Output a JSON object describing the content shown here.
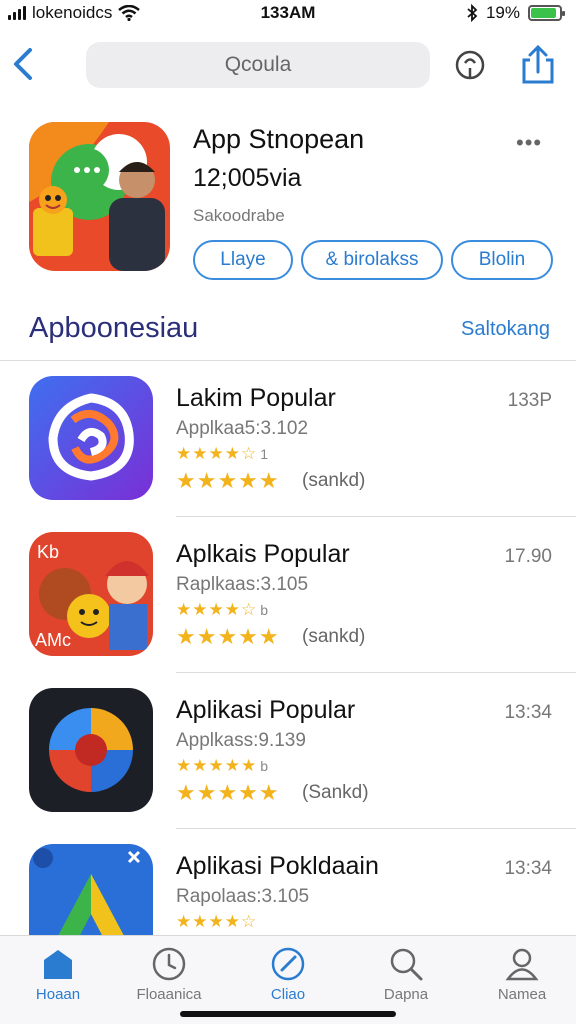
{
  "status_bar": {
    "carrier": "lokenoidcs",
    "time": "133AM",
    "battery_text": "19%",
    "battery_level": 0.9
  },
  "nav": {
    "search_placeholder": "Qcoula"
  },
  "featured": {
    "title": "App Stnopean",
    "subtitle": "12;005via",
    "developer": "Sakoodrabe",
    "more_label": "•••",
    "buttons": [
      "Llaye",
      "& birolakss",
      "Blolin"
    ]
  },
  "section": {
    "title": "Apboonesiau",
    "see_all": "Saltokang"
  },
  "apps": [
    {
      "name": "Lakim Popular",
      "subtitle": "Applkaa5:3.102",
      "size": "133P",
      "stars_small": "★★★★☆",
      "small_extra": "1",
      "stars_big": "★★★★★",
      "reviews": "(sankd)",
      "icon": "swirl-app-icon"
    },
    {
      "name": "Aplkais Popular",
      "subtitle": "Raplkaas:3.105",
      "size": "17.90",
      "stars_small": "★★★★☆",
      "small_extra": "b",
      "stars_big": "★★★★★",
      "reviews": "(sankd)",
      "icon": "cartoon-app-icon"
    },
    {
      "name": "Aplikasi Popular",
      "subtitle": "Applkass:9.139",
      "size": "13:34",
      "stars_small": "★★★★★",
      "small_extra": "b",
      "stars_big": "★★★★★",
      "reviews": "(Sankd)",
      "icon": "circle-app-icon"
    },
    {
      "name": "Aplikasi Pokldaain",
      "subtitle": "Rapolaas:3.105",
      "size": "13:34",
      "stars_small": "★★★★☆",
      "small_extra": "",
      "stars_big": "",
      "reviews": "",
      "icon": "arrow-app-icon"
    }
  ],
  "tabs": [
    {
      "label": "Hoaan",
      "icon": "home-icon",
      "active": true
    },
    {
      "label": "Floaanica",
      "icon": "clock-icon",
      "active": false
    },
    {
      "label": "Cliao",
      "icon": "compass-icon",
      "active": true
    },
    {
      "label": "Dapna",
      "icon": "search-icon",
      "active": false
    },
    {
      "label": "Namea",
      "icon": "person-icon",
      "active": false
    }
  ],
  "colors": {
    "accent": "#2a7cd0",
    "star": "#f2b31c",
    "section_title": "#2b2f7a"
  }
}
